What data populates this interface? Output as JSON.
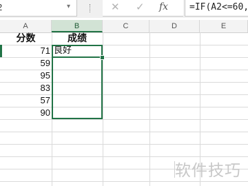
{
  "formula_bar": {
    "name_box": "2",
    "cancel_glyph": "✕",
    "enter_glyph": "✓",
    "fx_label": "fx",
    "formula": "=IF(A2<=60,"
  },
  "columns": [
    "A",
    "B",
    "C",
    "D",
    "E"
  ],
  "headers": {
    "a": "分数",
    "b": "成绩"
  },
  "rows": [
    {
      "score": "71",
      "grade": "良好"
    },
    {
      "score": "59",
      "grade": ""
    },
    {
      "score": "95",
      "grade": ""
    },
    {
      "score": "83",
      "grade": ""
    },
    {
      "score": "57",
      "grade": ""
    },
    {
      "score": "90",
      "grade": ""
    }
  ],
  "watermark": "软件技巧",
  "colors": {
    "accent": "#217346"
  }
}
